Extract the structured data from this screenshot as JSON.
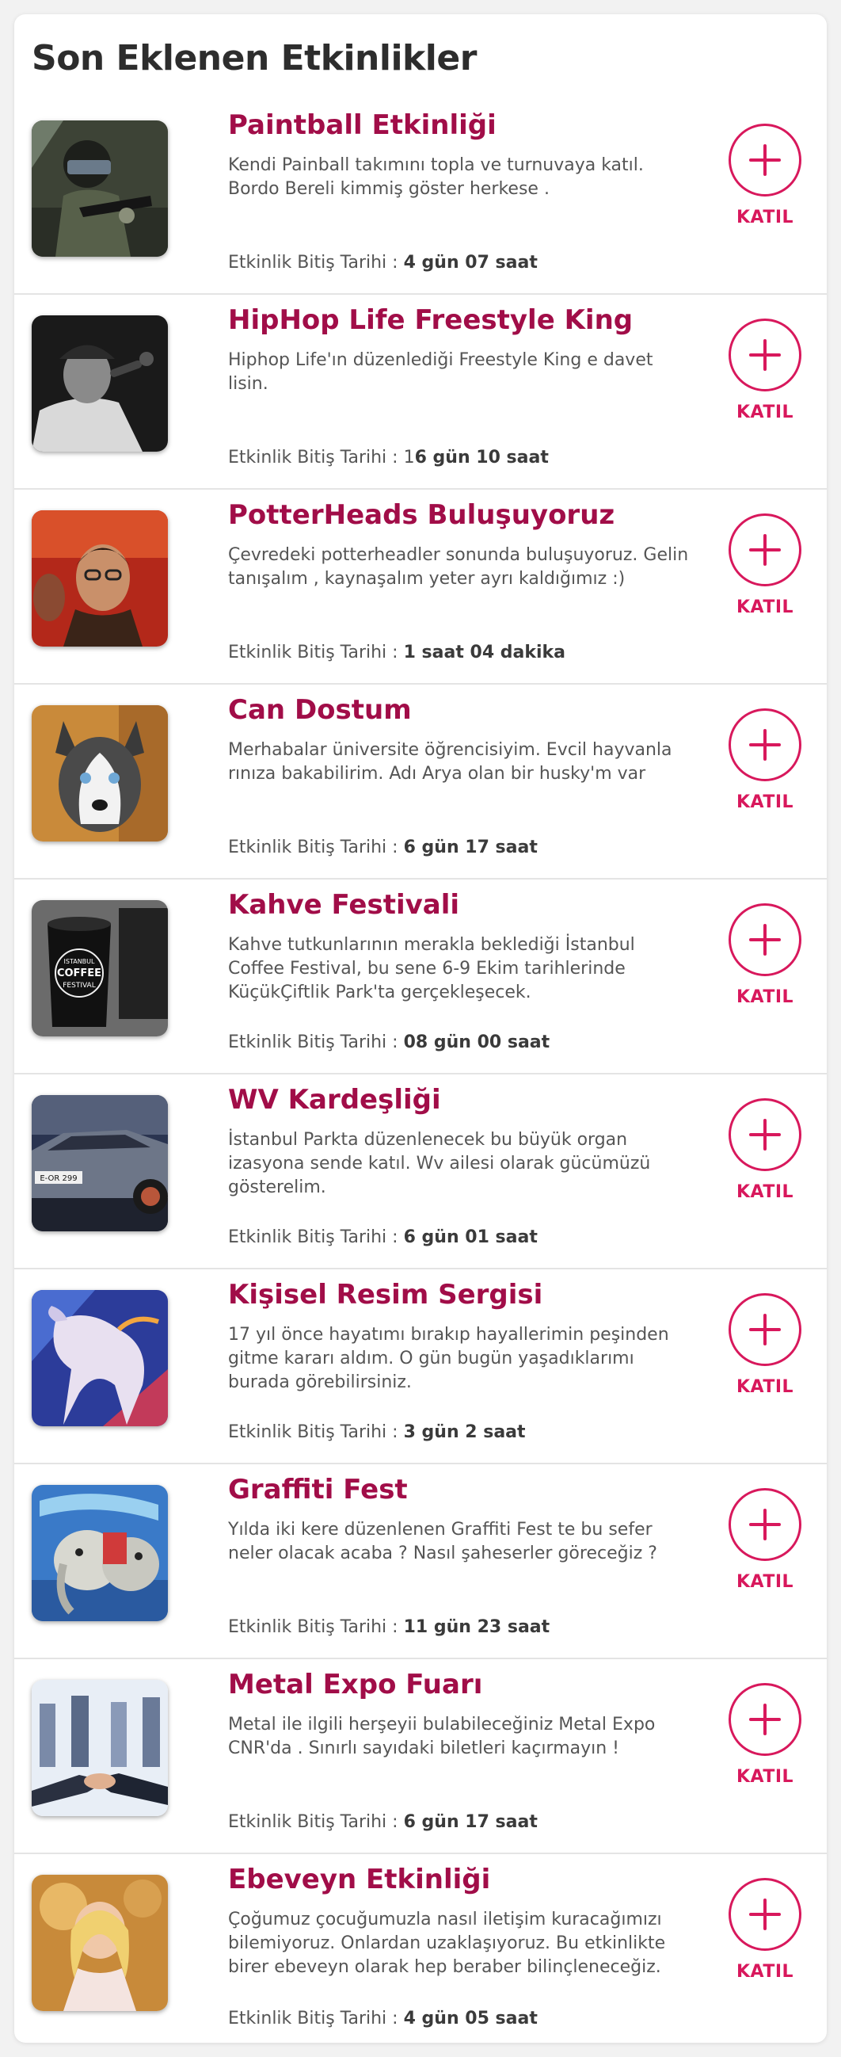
{
  "page": {
    "heading": "Son Eklenen Etkinlikler"
  },
  "colors": {
    "title": "#a10d48",
    "accent": "#d8185c",
    "text": "#555555"
  },
  "events": [
    {
      "title": "Paintball Etkinliği",
      "desc": "Kendi Painball takımını topla ve turnuvaya katıl. Bordo Bereli kimmiş göster herkese .",
      "deadline_label": "Etkinlik Bitiş Tarihi : ",
      "deadline_value": "4 gün 07 saat",
      "join_label": "KATIL",
      "image_icon": "paintball-photo"
    },
    {
      "title": "HipHop Life Freestyle King",
      "desc": "Hiphop Life'ın düzenlediği Freestyle King e davet lisin.",
      "deadline_label": "Etkinlik Bitiş Tarihi : 1",
      "deadline_value": "6 gün 10 saat",
      "join_label": "KATIL",
      "image_icon": "rapper-photo"
    },
    {
      "title": "PotterHeads Buluşuyoruz",
      "desc": "Çevredeki potterheadler sonunda buluşuyoruz. Gelin tanışalım , kaynaşalım yeter ayrı kaldığımız :)",
      "deadline_label": "Etkinlik Bitiş Tarihi : ",
      "deadline_value": "1 saat 04 dakika",
      "join_label": "KATIL",
      "image_icon": "harry-potter-photo"
    },
    {
      "title": "Can Dostum",
      "desc": "Merhabalar üniversite öğrencisiyim. Evcil hayvanla rınıza bakabilirim. Adı Arya olan bir husky'm var",
      "deadline_label": "Etkinlik Bitiş Tarihi : ",
      "deadline_value": "6 gün 17 saat",
      "join_label": "KATIL",
      "image_icon": "husky-photo"
    },
    {
      "title": "Kahve Festivali",
      "desc": "Kahve tutkunlarının merakla beklediği İstanbul Coffee Festival, bu sene 6-9 Ekim tarihlerinde KüçükÇiftlik Park'ta gerçekleşecek.",
      "deadline_label": "Etkinlik Bitiş Tarihi : ",
      "deadline_value": "08 gün 00 saat",
      "join_label": "KATIL",
      "image_icon": "coffee-cup-photo",
      "image_text": [
        "ISTANBUL",
        "COFFEE",
        "FESTIVAL"
      ]
    },
    {
      "title": "WV Kardeşliği",
      "desc": "İstanbul Parkta düzenlenecek bu büyük organ izasyona sende katıl. Wv ailesi olarak gücümüzü gösterelim.",
      "deadline_label": "Etkinlik Bitiş Tarihi : ",
      "deadline_value": "6 gün 01 saat",
      "join_label": "KATIL",
      "image_icon": "car-photo",
      "image_text": [
        "E-OR 299"
      ]
    },
    {
      "title": "Kişisel Resim Sergisi",
      "desc": "17 yıl önce hayatımı bırakıp hayallerimin peşinden gitme kararı aldım. O gün bugün yaşadıklarımı burada görebilirsiniz.",
      "deadline_label": "Etkinlik Bitiş Tarihi : ",
      "deadline_value": "3 gün 2 saat",
      "join_label": "KATIL",
      "image_icon": "horse-painting-photo"
    },
    {
      "title": "Graffiti Fest",
      "desc": "Yılda iki kere düzenlenen Graffiti Fest te bu sefer neler olacak acaba ? Nasıl şaheserler göreceğiz ?",
      "deadline_label": "Etkinlik Bitiş Tarihi : ",
      "deadline_value": "11 gün 23 saat",
      "join_label": "KATIL",
      "image_icon": "graffiti-photo"
    },
    {
      "title": "Metal Expo Fuarı",
      "desc": "Metal ile ilgili herşeyii bulabileceğiniz Metal Expo CNR'da . Sınırlı sayıdaki biletleri kaçırmayın !",
      "deadline_label": "Etkinlik Bitiş Tarihi : ",
      "deadline_value": "6 gün 17 saat",
      "join_label": "KATIL",
      "image_icon": "handshake-photo"
    },
    {
      "title": "Ebeveyn Etkinliği",
      "desc": "Çoğumuz çocuğumuzla nasıl iletişim kuracağımızı bilemiyoruz. Onlardan uzaklaşıyoruz. Bu etkinlikte birer ebeveyn olarak hep beraber bilinçleneceğiz.",
      "deadline_label": "Etkinlik Bitiş Tarihi : ",
      "deadline_value": "4 gün 05 saat",
      "join_label": "KATIL",
      "image_icon": "child-photo"
    }
  ]
}
